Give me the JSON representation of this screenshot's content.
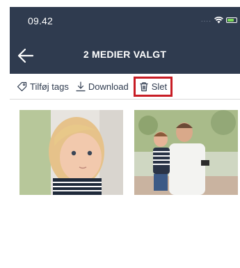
{
  "status_bar": {
    "time": "09.42",
    "signal_dots": "....",
    "battery_color": "#7bd957"
  },
  "header": {
    "title": "2 MEDIER VALGT",
    "background": "#2f3b4f"
  },
  "toolbar": {
    "add_tags_label": "Tilføj tags",
    "download_label": "Download",
    "delete_label": "Slet",
    "highlight_color": "#c81d25"
  },
  "media": {
    "items": [
      {
        "description_icon": "toddler-photo"
      },
      {
        "description_icon": "father-and-child-photo"
      }
    ]
  }
}
